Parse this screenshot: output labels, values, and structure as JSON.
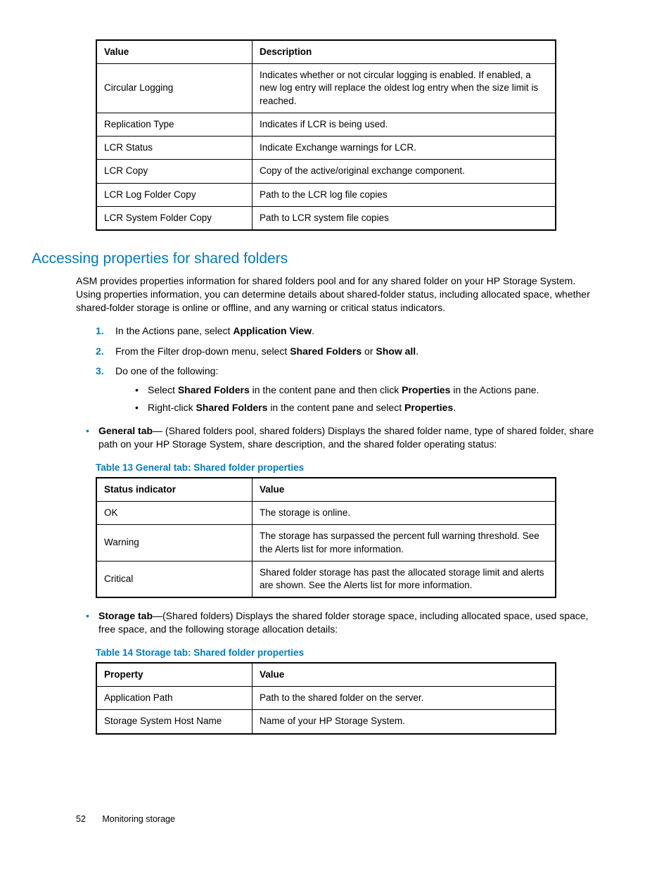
{
  "table1": {
    "headers": [
      "Value",
      "Description"
    ],
    "rows": [
      [
        "Circular Logging",
        "Indicates whether or not circular logging is enabled. If enabled, a new log entry will replace the oldest log entry when the size limit is reached."
      ],
      [
        "Replication Type",
        "Indicates if LCR is being used."
      ],
      [
        "LCR Status",
        "Indicate Exchange warnings for LCR."
      ],
      [
        "LCR Copy",
        "Copy of the active/original exchange component."
      ],
      [
        "LCR Log Folder Copy",
        "Path to the LCR log file copies"
      ],
      [
        "LCR System Folder Copy",
        "Path to LCR system file copies"
      ]
    ]
  },
  "section_heading": "Accessing properties for shared folders",
  "intro_para": "ASM provides properties information for shared folders pool and for any shared folder on your HP Storage System. Using properties information, you can determine details about shared-folder status, including allocated space, whether shared-folder storage is online or offline, and any warning or critical status indicators.",
  "steps": {
    "s1_a": "In the Actions pane, select ",
    "s1_b": "Application View",
    "s1_c": ".",
    "s2_a": "From the Filter drop-down menu, select ",
    "s2_b": "Shared Folders",
    "s2_c": " or ",
    "s2_d": "Show all",
    "s2_e": ".",
    "s3": "Do one of the following:",
    "s3_b1_a": "Select ",
    "s3_b1_b": "Shared Folders",
    "s3_b1_c": " in the content pane and then click ",
    "s3_b1_d": "Properties",
    "s3_b1_e": " in the Actions pane.",
    "s3_b2_a": "Right-click ",
    "s3_b2_b": "Shared Folders",
    "s3_b2_c": " in the content pane and select ",
    "s3_b2_d": "Properties",
    "s3_b2_e": "."
  },
  "general_tab": {
    "label": "General tab",
    "text": "— (Shared folders pool, shared folders) Displays the shared folder name, type of shared folder, share path on your HP Storage System, share description, and the shared folder operating status:"
  },
  "table13_caption": "Table 13 General tab: Shared folder properties",
  "table13": {
    "headers": [
      "Status indicator",
      "Value"
    ],
    "rows": [
      [
        "OK",
        "The storage is online."
      ],
      [
        "Warning",
        "The storage has surpassed the percent full warning threshold. See the Alerts list for more information."
      ],
      [
        "Critical",
        "Shared folder storage has past the allocated storage limit and alerts are shown. See the Alerts list for more information."
      ]
    ]
  },
  "storage_tab": {
    "label": "Storage tab",
    "text": "—(Shared folders) Displays the shared folder storage space, including allocated space, used space, free space, and the following storage allocation details:"
  },
  "table14_caption": "Table 14 Storage tab: Shared folder properties",
  "table14": {
    "headers": [
      "Property",
      "Value"
    ],
    "rows": [
      [
        "Application Path",
        "Path to the shared folder on the server."
      ],
      [
        "Storage System Host Name",
        "Name of your HP Storage System."
      ]
    ]
  },
  "footer": {
    "page": "52",
    "section": "Monitoring storage"
  }
}
